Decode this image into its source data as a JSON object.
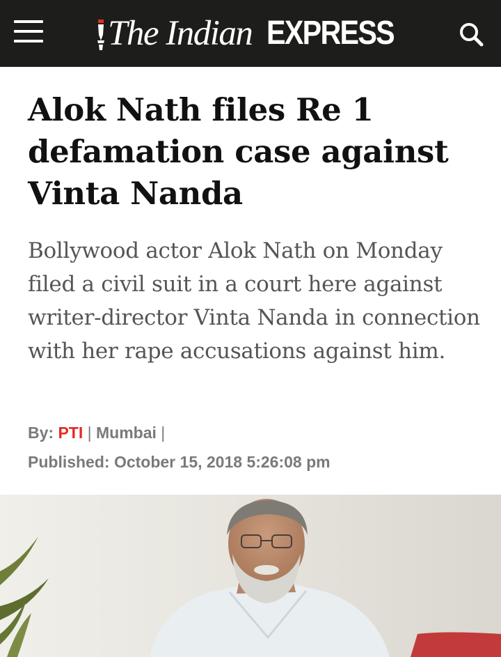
{
  "header": {
    "brand_italic": "The Indian",
    "brand_bold": "EXPRESS",
    "menu_icon": "hamburger-menu-icon",
    "search_icon": "search-icon",
    "background_color": "#1d1d1b"
  },
  "article": {
    "headline": "Alok Nath files Re 1 defamation case against Vinta Nanda",
    "summary": "Bollywood actor Alok Nath on Monday filed a civil suit in a court here against writer-director Vinta Nanda in connection with her rape accusations against him.",
    "byline": {
      "label": "By:",
      "author": "PTI",
      "separator": "|",
      "location": "Mumbai",
      "trailing_separator": "|"
    },
    "published": {
      "label": "Published:",
      "date": "October 15, 2018 5:26:08 pm"
    },
    "accent_color": "#e42a24"
  },
  "photo": {
    "subject": "man with grey beard and glasses in white shirt"
  }
}
